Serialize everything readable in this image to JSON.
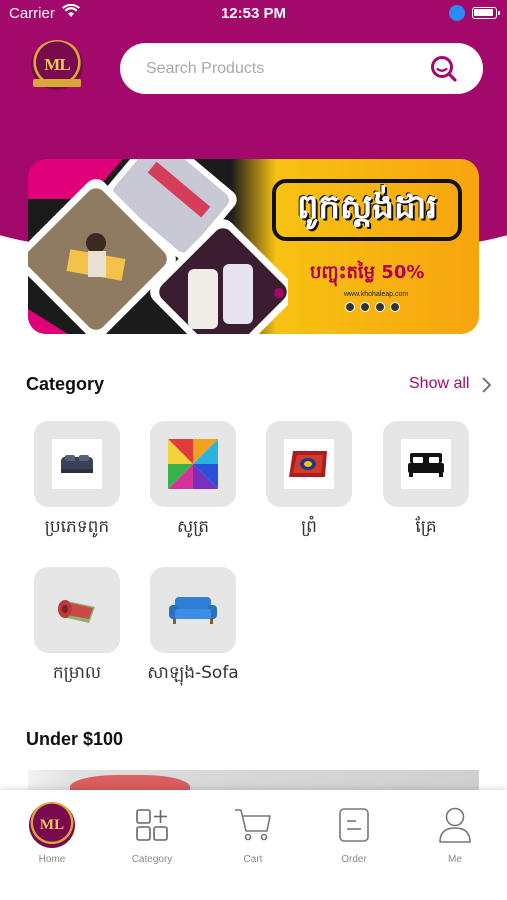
{
  "status_bar": {
    "carrier": "Carrier",
    "time": "12:53 PM"
  },
  "brand": {
    "logo_text": "ML",
    "accent_color": "#a3096a"
  },
  "search": {
    "placeholder": "Search Products"
  },
  "banner": {
    "title": "ពូកស្តង់ដារ",
    "subtitle": "បញ្ចុះតម្លៃ 50%",
    "url": "www.khohaleap.com"
  },
  "category_section": {
    "title": "Category",
    "show_all": "Show all",
    "items": [
      {
        "label": "ប្រភេទពូក",
        "icon": "mattress-icon"
      },
      {
        "label": "សូត្រ",
        "icon": "fabric-swatch-icon"
      },
      {
        "label": "ព្រំ",
        "icon": "carpet-icon"
      },
      {
        "label": "គ្រែ",
        "icon": "bed-icon"
      },
      {
        "label": "កម្រាល",
        "icon": "rolled-mat-icon"
      },
      {
        "label": "សាឡុង-Sofa",
        "icon": "sofa-icon"
      }
    ]
  },
  "under_section": {
    "title": "Under $100"
  },
  "tab_bar": {
    "items": [
      {
        "label": "Home",
        "icon": "home-logo-icon"
      },
      {
        "label": "Category",
        "icon": "grid-plus-icon"
      },
      {
        "label": "Cart",
        "icon": "cart-icon"
      },
      {
        "label": "Order",
        "icon": "order-icon"
      },
      {
        "label": "Me",
        "icon": "profile-icon"
      }
    ]
  }
}
